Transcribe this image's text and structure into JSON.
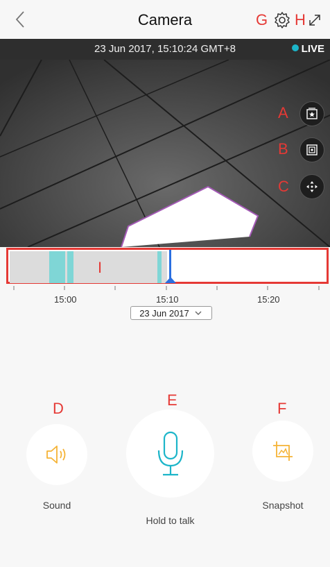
{
  "header": {
    "title": "Camera",
    "annot_g": "G",
    "annot_h": "H"
  },
  "video": {
    "timestamp": "23 Jun 2017, 15:10:24 GMT+8",
    "live_label": "LIVE",
    "live_color": "#1cb5c9",
    "annot_a": "A",
    "annot_b": "B",
    "annot_c": "C"
  },
  "timeline": {
    "annot_i": "I",
    "ticks": [
      "15:00",
      "15:10",
      "15:20"
    ],
    "date_value": "23 Jun 2017"
  },
  "controls": {
    "sound_label": "Sound",
    "talk_label": "Hold to talk",
    "snapshot_label": "Snapshot",
    "annot_d": "D",
    "annot_e": "E",
    "annot_f": "F",
    "mic_color": "#1cb5c9",
    "accent_color": "#f5b335"
  }
}
